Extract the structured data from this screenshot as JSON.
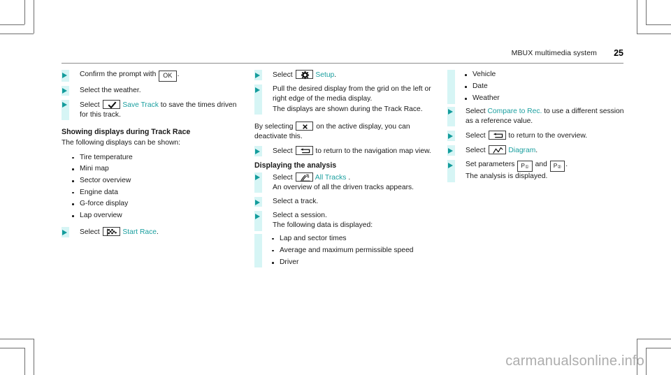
{
  "header": {
    "title": "MBUX multimedia system",
    "page_number": "25"
  },
  "colors": {
    "teal_accent": "#1a9f9f",
    "teal_bar": "#d6f5f5",
    "arrow": "#149c9c",
    "watermark": "#adadad"
  },
  "column1": {
    "step_confirm": {
      "pre": "Confirm the prompt with",
      "key": "OK",
      "post": "."
    },
    "step_weather": {
      "text": "Select the weather."
    },
    "step_save_track": {
      "pre": "Select",
      "icon": "checkmark-icon",
      "link": "Save Track",
      "post": "to save the times driven for this track."
    },
    "heading_showing": "Showing displays during Track Race",
    "intro": "The following displays can be shown:",
    "display_list": [
      "Tire temperature",
      "Mini map",
      "Sector overview",
      "Engine data",
      "G-force display",
      "Lap overview"
    ],
    "step_start_race": {
      "pre": "Select",
      "icon": "checkered-flag-icon",
      "link": "Start Race",
      "post": "."
    }
  },
  "column2": {
    "step_setup": {
      "pre": "Select",
      "icon": "gear-icon",
      "link": "Setup",
      "post": "."
    },
    "step_pull": {
      "text": "Pull the desired display from the grid on the left or right edge of the media display.",
      "note": "The displays are shown during the Track Race."
    },
    "para_deactivate": {
      "pre": "By selecting",
      "icon": "close-x-icon",
      "post": "on the active display, you can deactivate this."
    },
    "step_return_nav": {
      "pre": "Select",
      "icon": "return-arrow-icon",
      "post": "to return to the navigation map view."
    },
    "heading_analysis": "Displaying the analysis",
    "step_all_tracks": {
      "pre": "Select",
      "icon": "all-tracks-icon",
      "link": "All Tracks",
      "post": ".",
      "note": "An overview of all the driven tracks appears."
    },
    "step_select_track": {
      "text": "Select a track."
    },
    "step_select_session": {
      "text": "Select a session.",
      "note": "The following data is displayed:"
    },
    "session_data_list": [
      "Lap and sector times",
      "Average and maximum permissible speed",
      "Driver"
    ]
  },
  "column3": {
    "session_data_continued": [
      "Vehicle",
      "Date",
      "Weather"
    ],
    "step_compare": {
      "pre": "Select",
      "link": "Compare to Rec.",
      "post": "to use a different session as a reference value."
    },
    "step_return_overview": {
      "pre": "Select",
      "icon": "return-arrow-icon",
      "post": "to return to the overview."
    },
    "step_diagram": {
      "pre": "Select",
      "icon": "diagram-icon",
      "link": "Diagram",
      "post": "."
    },
    "step_parameters": {
      "pre": "Set parameters",
      "p1_label": "P",
      "p1_sub": "①",
      "conj": "and",
      "p2_label": "P",
      "p2_sub": "②",
      "post": ".",
      "note": "The analysis is displayed."
    }
  },
  "watermark": {
    "text": "carmanualsonline.info"
  }
}
